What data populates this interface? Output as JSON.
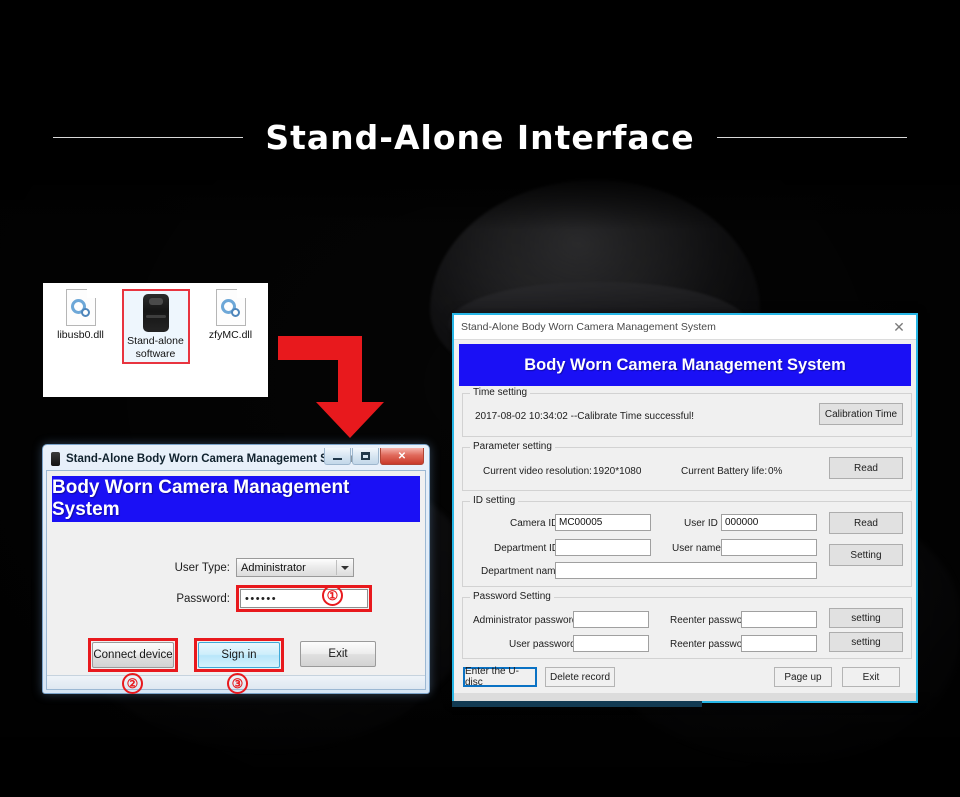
{
  "heading": {
    "title": "Stand-Alone Interface"
  },
  "explorer": {
    "files": [
      {
        "label": "libusb0.dll",
        "icon": "dll-file-icon",
        "selected": false
      },
      {
        "label": "Stand-alone software",
        "icon": "body-camera-icon",
        "selected": true
      },
      {
        "label": "zfyMC.dll",
        "icon": "dll-file-icon",
        "selected": false
      }
    ]
  },
  "arrow": {
    "name": "red-elbow-arrow",
    "color": "#e8191d"
  },
  "login_window": {
    "title": "Stand-Alone Body Worn Camera Management System",
    "banner": "Body Worn Camera Management System",
    "banner_color": "#1a10f5",
    "window_buttons": {
      "minimize": "minimize-icon",
      "maximize": "maximize-icon",
      "close": "✕"
    },
    "fields": {
      "user_type_label": "User Type:",
      "user_type_value": "Administrator",
      "password_label": "Password:",
      "password_value": "••••••"
    },
    "buttons": {
      "connect": "Connect device",
      "signin": "Sign in",
      "exit": "Exit"
    }
  },
  "markers": {
    "one": "①",
    "two": "②",
    "three": "③"
  },
  "main_window": {
    "title": "Stand-Alone Body Worn Camera Management System",
    "close_glyph": "✕",
    "banner": "Body Worn Camera Management System",
    "time_setting": {
      "group_title": "Time setting",
      "status": "2017-08-02 10:34:02 --Calibrate Time successful!",
      "button": "Calibration Time"
    },
    "parameter_setting": {
      "group_title": "Parameter setting",
      "resolution_label": "Current video resolution:",
      "resolution_value": "1920*1080",
      "battery_label": "Current Battery life:",
      "battery_value": "0%",
      "button": "Read"
    },
    "id_setting": {
      "group_title": "ID setting",
      "camera_id_label": "Camera ID",
      "camera_id_value": "MC00005",
      "user_id_label": "User ID",
      "user_id_value": "000000",
      "department_id_label": "Department ID",
      "department_id_value": "",
      "user_name_label": "User name",
      "user_name_value": "",
      "department_name_label": "Department name",
      "department_name_value": "",
      "read_button": "Read",
      "setting_button": "Setting"
    },
    "password_setting": {
      "group_title": "Password Setting",
      "admin_password_label": "Administrator password",
      "admin_password_value": "",
      "admin_reenter_label": "Reenter password",
      "admin_reenter_value": "",
      "user_password_label": "User password",
      "user_password_value": "",
      "user_reenter_label": "Reenter password",
      "user_reenter_value": "",
      "admin_setting_button": "setting",
      "user_setting_button": "setting"
    },
    "footer": {
      "udisc": "Enter the U-disc",
      "delete_record": "Delete record",
      "page_up": "Page up",
      "exit": "Exit"
    }
  }
}
